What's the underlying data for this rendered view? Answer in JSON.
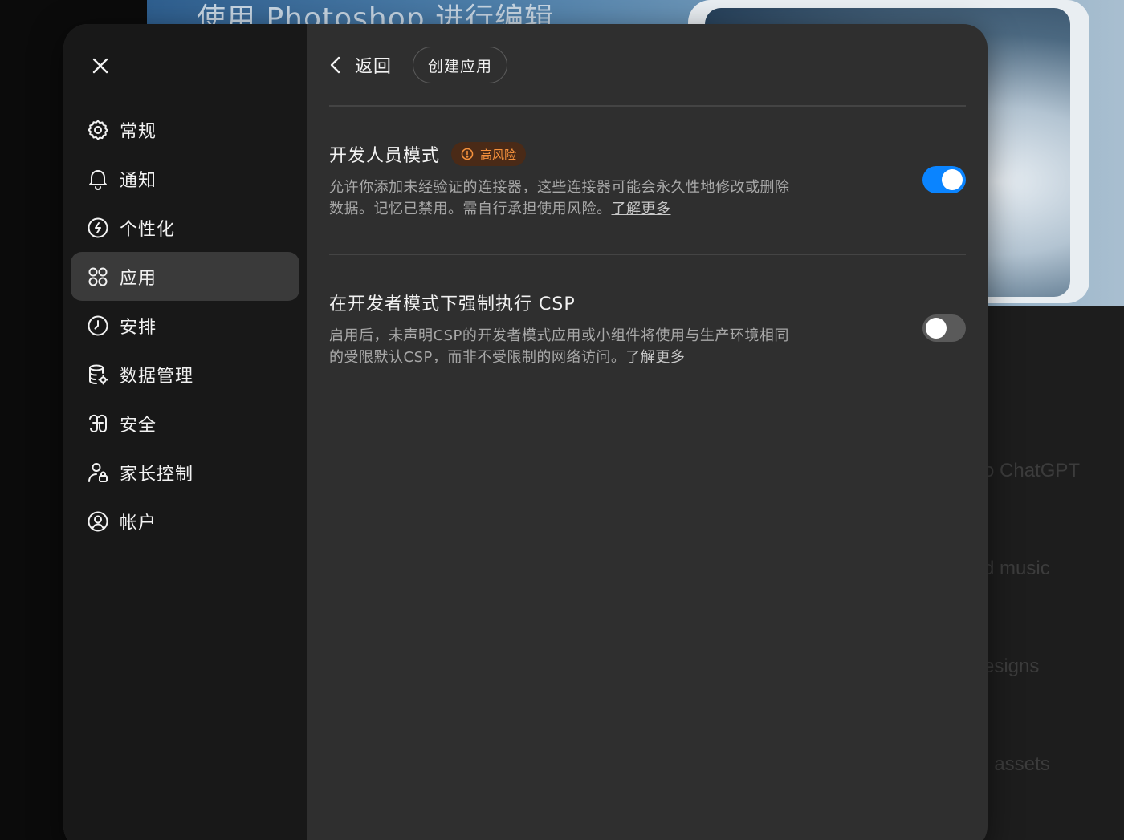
{
  "background": {
    "banner_title": "使用 Photoshop 进行编辑",
    "list_items": [
      "o ChatGPT",
      "d music",
      "esigns",
      ", assets"
    ]
  },
  "sidebar": {
    "close_label": "×",
    "items": [
      {
        "label": "常规",
        "icon": "gear-icon",
        "active": false
      },
      {
        "label": "通知",
        "icon": "bell-icon",
        "active": false
      },
      {
        "label": "个性化",
        "icon": "personalize-icon",
        "active": false
      },
      {
        "label": "应用",
        "icon": "apps-grid-icon",
        "active": true
      },
      {
        "label": "安排",
        "icon": "clock-icon",
        "active": false
      },
      {
        "label": "数据管理",
        "icon": "database-gear-icon",
        "active": false
      },
      {
        "label": "安全",
        "icon": "security-icon",
        "active": false
      },
      {
        "label": "家长控制",
        "icon": "parental-control-icon",
        "active": false
      },
      {
        "label": "帐户",
        "icon": "user-circle-icon",
        "active": false
      }
    ]
  },
  "header": {
    "back_label": "返回",
    "create_app_label": "创建应用"
  },
  "settings": [
    {
      "title": "开发人员模式",
      "badge": "高风险",
      "description": "允许你添加未经验证的连接器，这些连接器可能会永久性地修改或删除数据。记忆已禁用。需自行承担使用风险。",
      "link": "了解更多",
      "enabled": true
    },
    {
      "title": "在开发者模式下强制执行 CSP",
      "description": "启用后，未声明CSP的开发者模式应用或小组件将使用与生产环境相同的受限默认CSP，而非不受限制的网络访问。",
      "link": "了解更多",
      "enabled": false
    }
  ],
  "colors": {
    "accent": "#0a84ff",
    "risk": "#f6913c",
    "sidebar_bg": "#181818",
    "panel_bg": "#2f2f2f"
  }
}
